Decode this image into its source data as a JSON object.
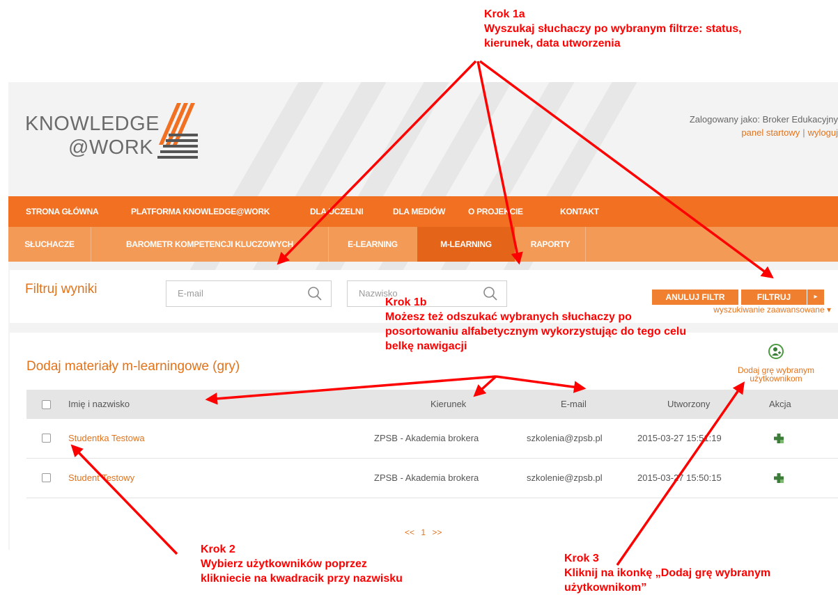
{
  "header": {
    "logo_line1": "KNOWLEDGE",
    "logo_line2": "@WORK",
    "logged_in_as": "Zalogowany jako: Broker Edukacyjny",
    "link_panel": "panel startowy",
    "link_separator": "|",
    "link_logout": "wyloguj"
  },
  "main_nav": [
    "STRONA GŁÓWNA",
    "PLATFORMA KNOWLEDGE@WORK",
    "DLA UCZELNI",
    "DLA MEDIÓW",
    "O PROJEKCIE",
    "KONTAKT"
  ],
  "sub_nav": [
    "SŁUCHACZE",
    "BAROMETR KOMPETENCJI KLUCZOWYCH",
    "E-LEARNING",
    "M-LEARNING",
    "RAPORTY"
  ],
  "sub_nav_active": "M-LEARNING",
  "filter": {
    "title": "Filtruj wyniki",
    "email_placeholder": "E-mail",
    "name_placeholder": "Nazwisko",
    "cancel_label": "ANULUJ FILTR",
    "filter_label": "FILTRUJ",
    "split_arrow": "▸",
    "advanced_label": "wyszukiwanie zaawansowane ▾"
  },
  "table": {
    "title": "Dodaj materiały m-learningowe (gry)",
    "add_label_line1": "Dodaj grę wybranym",
    "add_label_line2": "użytkownikom",
    "columns": [
      "Imię i nazwisko",
      "Kierunek",
      "E-mail",
      "Utworzony",
      "Akcja"
    ],
    "rows": [
      {
        "name": "Studentka Testowa",
        "kierunek": "ZPSB - Akademia brokera",
        "email": "szkolenia@zpsb.pl",
        "created": "2015-03-27 15:51:19"
      },
      {
        "name": "Student Testowy",
        "kierunek": "ZPSB - Akademia brokera",
        "email": "szkolenie@zpsb.pl",
        "created": "2015-03-27 15:50:15"
      }
    ],
    "pager": [
      "<<",
      "1",
      ">>"
    ]
  },
  "annotations": {
    "step1a": [
      "Krok 1a",
      "Wyszukaj słuchaczy po wybranym filtrze: status,",
      "kierunek, data utworzenia"
    ],
    "step1b": [
      "Krok 1b",
      "Możesz też odszukać wybranych słuchaczy po",
      "posortowaniu  alfabetycznym wykorzystując do tego celu",
      "belkę nawigacji"
    ],
    "step2": [
      "Krok 2",
      "Wybierz użytkowników poprzez",
      "klikniecie na kwadracik przy nazwisku"
    ],
    "step3": [
      "Krok 3",
      "Kliknij na ikonkę  „Dodaj grę wybranym",
      "użytkownikom”"
    ]
  },
  "colors": {
    "accent": "#f17022",
    "submenu": "#f39a57",
    "link": "#e2731b",
    "annotation": "#ff0000",
    "icon_green": "#3c7d3a"
  }
}
